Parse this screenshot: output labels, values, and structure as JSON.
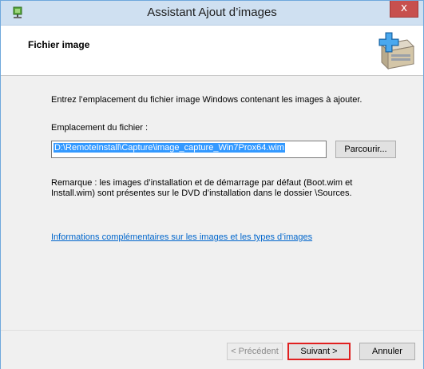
{
  "window": {
    "title": "Assistant Ajout d’images",
    "close_label": "x"
  },
  "header": {
    "title": "Fichier image"
  },
  "content": {
    "instructions": "Entrez l’emplacement du fichier image Windows contenant les images à ajouter.",
    "file_location_label": "Emplacement du fichier :",
    "file_path_value": "D:\\RemoteInstall\\Capture\\image_capture_Win7Prox64.wim",
    "browse_label": "Parcourir...",
    "remark": "Remarque : les images d’installation et de démarrage par défaut (Boot.wim et Install.wim) sont présentes sur le DVD d’installation dans le dossier \\Sources.",
    "info_link": "Informations complémentaires sur les images et les types d’images"
  },
  "footer": {
    "previous_label": "< Précédent",
    "next_label": "Suivant >",
    "cancel_label": "Annuler"
  },
  "colors": {
    "titlebar": "#cfe0f1",
    "close_button": "#c7504e",
    "selection": "#3399ff",
    "link": "#0066cc",
    "highlight_border": "#e02020"
  },
  "icons": {
    "title_icon": "wds-server-icon",
    "header_icon": "add-image-box-icon"
  }
}
